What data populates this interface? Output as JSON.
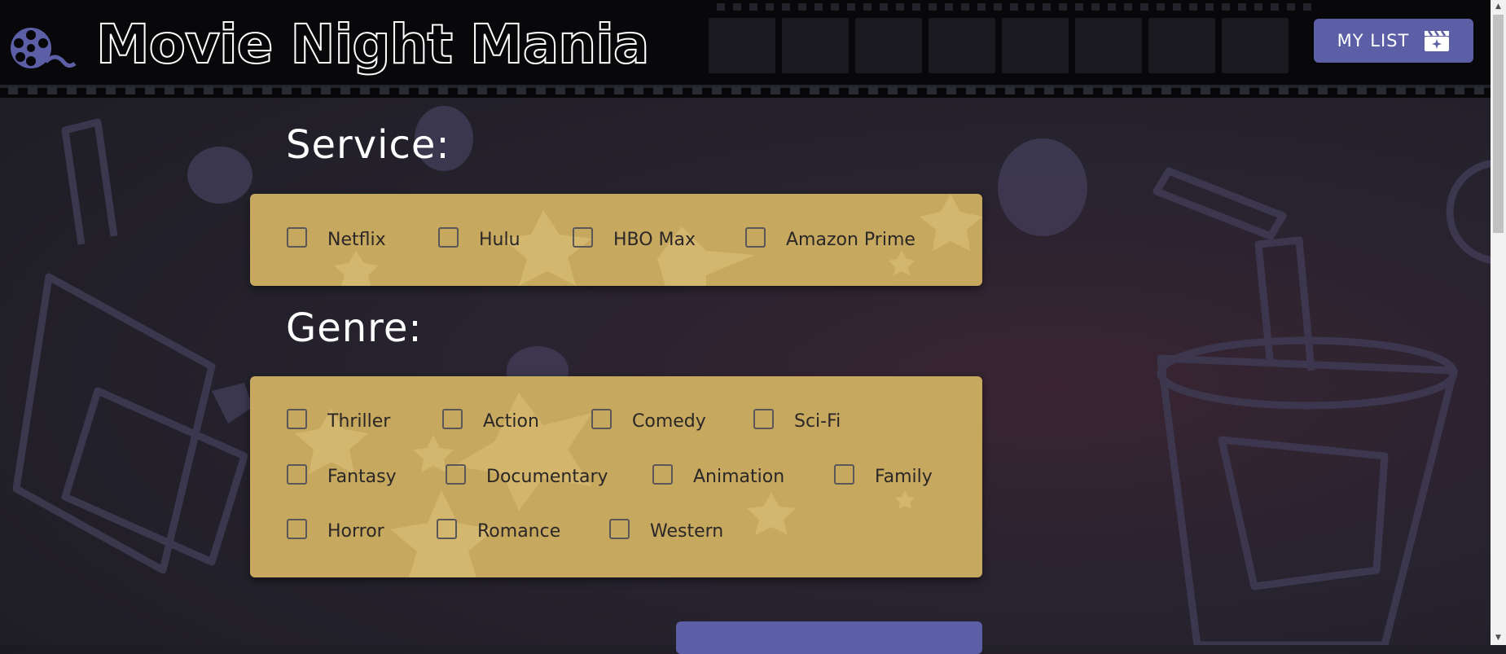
{
  "header": {
    "title": "Movie Night Mania",
    "my_list_label": "MY LIST"
  },
  "service": {
    "title": "Service:",
    "options": [
      "Netflix",
      "Hulu",
      "HBO Max",
      "Amazon Prime"
    ]
  },
  "genre": {
    "title": "Genre:",
    "options": [
      "Thriller",
      "Action",
      "Comedy",
      "Sci-Fi",
      "Fantasy",
      "Documentary",
      "Animation",
      "Family",
      "Horror",
      "Romance",
      "Western"
    ]
  },
  "colors": {
    "accent": "#5c5fa6",
    "panel": "#c6a85f",
    "header": "#07070a"
  },
  "icons": [
    "film-reel-logo-icon",
    "clapperboard-sparkle-icon"
  ]
}
